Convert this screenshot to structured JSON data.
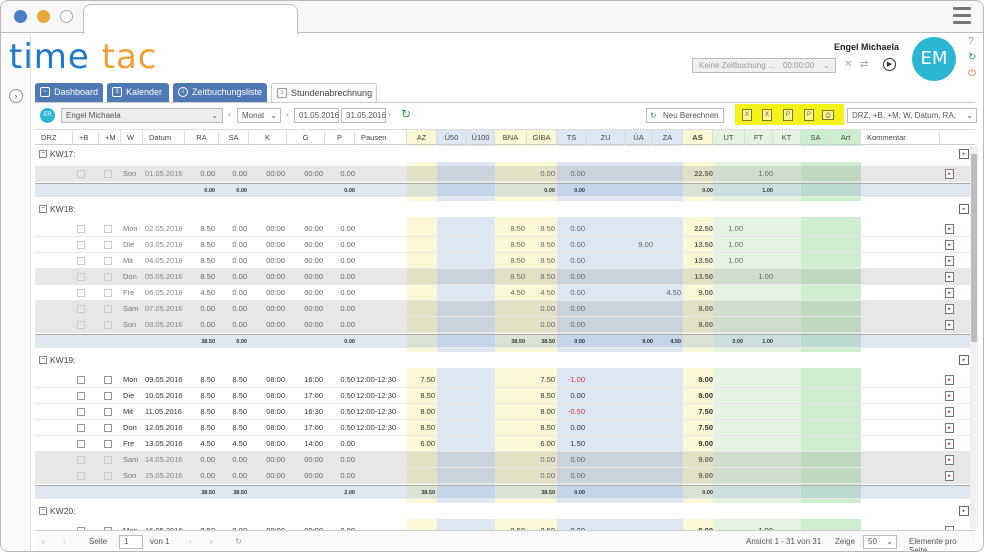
{
  "app": {
    "logo_t": "t",
    "logo_ime": "ime",
    "logo_tac": "tac"
  },
  "user": {
    "name": "Engel Michaela",
    "initials": "EM"
  },
  "header": {
    "booking_placeholder": "Keine Zeitbuchung ...",
    "booking_time": "00:00:00"
  },
  "tabs": [
    {
      "label": "Dashboard",
      "icon": "chart-icon",
      "active": false
    },
    {
      "label": "Kalender",
      "icon": "calendar-icon",
      "active": false
    },
    {
      "label": "Zeitbuchungsliste",
      "icon": "clock-icon",
      "active": false
    },
    {
      "label": "Stundenabrechnung",
      "icon": "report-icon",
      "active": true
    }
  ],
  "toolbar": {
    "user_badge": "ER",
    "user_select": "Engel Michaela",
    "period": "Monat",
    "date_from": "01.05.2016",
    "date_to": "31.05.2016",
    "recalc_label": "Neu Berechnen",
    "column_select": "DRZ, +B, +M, W, Datum, RA,"
  },
  "columns": [
    "DRZ",
    "+B",
    "+M",
    "W",
    "Datum",
    "RA",
    "SA",
    "K",
    "G",
    "P",
    "Pausen",
    "AZ",
    "Ü50",
    "Ü100",
    "BNA",
    "GIBA",
    "TS",
    "ZU",
    "ÜA",
    "ZA",
    "AS",
    "UT",
    "FT",
    "KT",
    "SA",
    "Art",
    "Kommentar"
  ],
  "weeks": [
    {
      "label": "KW17:",
      "rows": [
        {
          "type": "g",
          "w": "Son",
          "d": "01.05.2016",
          "ra": "0.00",
          "sa": "0.00",
          "k": "00:00",
          "g": "00:00",
          "p": "0.00",
          "pa": "",
          "az": "",
          "bna": "",
          "giba": "0.00",
          "ts": "0.00",
          "ua": "",
          "za": "",
          "as": "22.50",
          "ut": "",
          "ft": "1.00"
        }
      ],
      "sum": {
        "ra": "0.00",
        "sa": "0.00",
        "p": "0.00",
        "az": "",
        "bna": "",
        "giba": "0.00",
        "ts": "0.00",
        "ua": "",
        "za": "",
        "as": "0.00",
        "ut": "",
        "ft": "1.00"
      }
    },
    {
      "label": "KW18:",
      "rows": [
        {
          "type": "p",
          "w": "Mon",
          "d": "02.05.2016",
          "ra": "8.50",
          "sa": "0.00",
          "k": "00:00",
          "g": "00:00",
          "p": "0.00",
          "pa": "",
          "az": "",
          "bna": "8.50",
          "giba": "8.50",
          "ts": "0.00",
          "ua": "",
          "za": "",
          "as": "22.50",
          "ut": "1.00",
          "ft": ""
        },
        {
          "type": "p",
          "w": "Die",
          "d": "03.05.2016",
          "ra": "8.50",
          "sa": "0.00",
          "k": "00:00",
          "g": "00:00",
          "p": "0.00",
          "pa": "",
          "az": "",
          "bna": "8.50",
          "giba": "8.50",
          "ts": "0.00",
          "ua": "9.00",
          "za": "",
          "as": "13.50",
          "ut": "1.00",
          "ft": ""
        },
        {
          "type": "p",
          "w": "Mit",
          "d": "04.05.2016",
          "ra": "8.50",
          "sa": "0.00",
          "k": "00:00",
          "g": "00:00",
          "p": "0.00",
          "pa": "",
          "az": "",
          "bna": "8.50",
          "giba": "8.50",
          "ts": "0.00",
          "ua": "",
          "za": "",
          "as": "13.50",
          "ut": "1.00",
          "ft": ""
        },
        {
          "type": "g",
          "w": "Don",
          "d": "05.05.2016",
          "ra": "8.50",
          "sa": "0.00",
          "k": "00:00",
          "g": "00:00",
          "p": "0.00",
          "pa": "",
          "az": "",
          "bna": "8.50",
          "giba": "8.50",
          "ts": "0.00",
          "ua": "",
          "za": "",
          "as": "13.50",
          "ut": "",
          "ft": "1.00"
        },
        {
          "type": "p",
          "w": "Fre",
          "d": "06.05.2016",
          "ra": "4.50",
          "sa": "0.00",
          "k": "00:00",
          "g": "00:00",
          "p": "0.00",
          "pa": "",
          "az": "",
          "bna": "4.50",
          "giba": "4.50",
          "ts": "0.00",
          "ua": "",
          "za": "4.50",
          "as": "9.00",
          "ut": "",
          "ft": ""
        },
        {
          "type": "g",
          "w": "Sam",
          "d": "07.05.2016",
          "ra": "0.00",
          "sa": "0.00",
          "k": "00:00",
          "g": "00:00",
          "p": "0.00",
          "pa": "",
          "az": "",
          "bna": "",
          "giba": "0.00",
          "ts": "0.00",
          "ua": "",
          "za": "",
          "as": "9.00",
          "ut": "",
          "ft": ""
        },
        {
          "type": "g",
          "w": "Son",
          "d": "08.05.2016",
          "ra": "0.00",
          "sa": "0.00",
          "k": "00:00",
          "g": "00:00",
          "p": "0.00",
          "pa": "",
          "az": "",
          "bna": "",
          "giba": "0.00",
          "ts": "0.00",
          "ua": "",
          "za": "",
          "as": "9.00",
          "ut": "",
          "ft": ""
        }
      ],
      "sum": {
        "ra": "38.50",
        "sa": "0.00",
        "p": "0.00",
        "az": "",
        "bna": "38.50",
        "giba": "38.50",
        "ts": "0.00",
        "ua": "9.00",
        "za": "4.50",
        "as": "",
        "ut": "3.00",
        "ft": "1.00"
      }
    },
    {
      "label": "KW19:",
      "rows": [
        {
          "type": "n",
          "w": "Mon",
          "d": "09.05.2016",
          "ra": "8.50",
          "sa": "8.50",
          "k": "08:00",
          "g": "16:00",
          "p": "0.50",
          "pa": "12:00-12:30",
          "az": "7.50",
          "bna": "",
          "giba": "7.50",
          "ts": "-1.00",
          "ua": "",
          "za": "",
          "as": "8.00",
          "ut": "",
          "ft": ""
        },
        {
          "type": "n",
          "w": "Die",
          "d": "10.05.2016",
          "ra": "8.50",
          "sa": "8.50",
          "k": "08:00",
          "g": "17:00",
          "p": "0.50",
          "pa": "12:00-12:30",
          "az": "8.50",
          "bna": "",
          "giba": "8.50",
          "ts": "0.00",
          "ua": "",
          "za": "",
          "as": "8.00",
          "ut": "",
          "ft": ""
        },
        {
          "type": "n",
          "w": "Mit",
          "d": "11.05.2016",
          "ra": "8.50",
          "sa": "8.50",
          "k": "08:00",
          "g": "16:30",
          "p": "0.50",
          "pa": "12:00-12:30",
          "az": "8.00",
          "bna": "",
          "giba": "8.00",
          "ts": "-0.50",
          "ua": "",
          "za": "",
          "as": "7.50",
          "ut": "",
          "ft": ""
        },
        {
          "type": "n",
          "w": "Don",
          "d": "12.05.2016",
          "ra": "8.50",
          "sa": "8.50",
          "k": "08:00",
          "g": "17:00",
          "p": "0.50",
          "pa": "12:00-12:30",
          "az": "8.50",
          "bna": "",
          "giba": "8.50",
          "ts": "0.00",
          "ua": "",
          "za": "",
          "as": "7.50",
          "ut": "",
          "ft": ""
        },
        {
          "type": "n",
          "w": "Fre",
          "d": "13.05.2016",
          "ra": "4.50",
          "sa": "4.50",
          "k": "08:00",
          "g": "14:00",
          "p": "0.00",
          "pa": "",
          "az": "6.00",
          "bna": "",
          "giba": "6.00",
          "ts": "1.50",
          "ua": "",
          "za": "",
          "as": "9.00",
          "ut": "",
          "ft": ""
        },
        {
          "type": "g",
          "w": "Sam",
          "d": "14.05.2016",
          "ra": "0.00",
          "sa": "0.00",
          "k": "00:00",
          "g": "00:00",
          "p": "0.00",
          "pa": "",
          "az": "",
          "bna": "",
          "giba": "0.00",
          "ts": "0.00",
          "ua": "",
          "za": "",
          "as": "9.00",
          "ut": "",
          "ft": ""
        },
        {
          "type": "g",
          "w": "Son",
          "d": "15.05.2016",
          "ra": "0.00",
          "sa": "0.00",
          "k": "00:00",
          "g": "00:00",
          "p": "0.00",
          "pa": "",
          "az": "",
          "bna": "",
          "giba": "0.00",
          "ts": "0.00",
          "ua": "",
          "za": "",
          "as": "9.00",
          "ut": "",
          "ft": ""
        }
      ],
      "sum": {
        "ra": "38.50",
        "sa": "38.50",
        "p": "2.00",
        "az": "38.50",
        "bna": "",
        "giba": "38.50",
        "ts": "0.00",
        "ua": "",
        "za": "",
        "as": "0.00",
        "ut": "",
        "ft": ""
      }
    },
    {
      "label": "KW20:",
      "rows": [
        {
          "type": "n",
          "w": "Mon",
          "d": "16.05.2016",
          "ra": "8.50",
          "sa": "0.00",
          "k": "00:00",
          "g": "00:00",
          "p": "0.00",
          "pa": "",
          "az": "",
          "bna": "8.50",
          "giba": "8.50",
          "ts": "0.00",
          "ua": "",
          "za": "",
          "as": "9.00",
          "ut": "",
          "ft": "1.00"
        }
      ]
    }
  ],
  "footer": {
    "page_label": "Seite",
    "page": "1",
    "of_label": "von 1",
    "view_info": "Ansicht 1 - 31 von 31",
    "show_label": "Zeige",
    "per_page": "50",
    "per_page_label": "Elemente pro Seite"
  },
  "colors": {
    "blue": "#4f79b5",
    "yellow_highlight": "#f5f21a",
    "avatar": "#2bb7d4"
  }
}
